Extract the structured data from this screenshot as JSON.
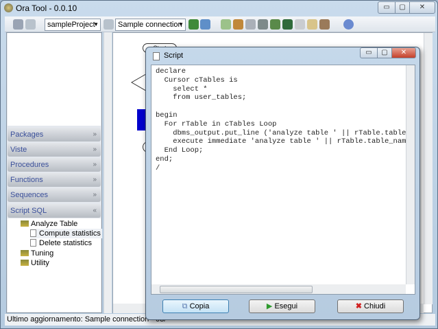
{
  "window": {
    "title": "Ora Tool - 0.0.10",
    "app_icon": "gear-icon"
  },
  "toolbar": {
    "project": "sampleProject",
    "connection": "Sample connection",
    "icons": [
      "save-icon",
      "wrench-icon",
      "wrench-icon",
      "connect-icon",
      "refresh-icon",
      "script-icon",
      "books-icon",
      "print-icon",
      "export-icon",
      "edit-icon",
      "table-icon",
      "compare-icon",
      "document-icon",
      "tool-icon",
      "info-icon"
    ]
  },
  "sidebar": {
    "sections": [
      {
        "label": "Packages",
        "expanded": false
      },
      {
        "label": "Viste",
        "expanded": false
      },
      {
        "label": "Procedures",
        "expanded": false
      },
      {
        "label": "Functions",
        "expanded": false
      },
      {
        "label": "Sequences",
        "expanded": false
      },
      {
        "label": "Script SQL",
        "expanded": true
      }
    ],
    "tree": [
      {
        "label": "Analyze Table",
        "type": "folder"
      },
      {
        "label": "Compute statistics",
        "type": "file",
        "selected": true
      },
      {
        "label": "Delete statistics",
        "type": "file"
      },
      {
        "label": "Tuning",
        "type": "folder"
      },
      {
        "label": "Utility",
        "type": "folder"
      }
    ]
  },
  "canvas": {
    "start_label": "Start"
  },
  "status": {
    "text": "Ultimo aggiornamento: Sample connection - 03/"
  },
  "dialog": {
    "title": "Script",
    "code": "declare\n  Cursor cTables is\n    select *\n    from user_tables;\n\nbegin\n  For rTable in cTables Loop\n    dbms_output.put_line ('analyze table ' || rTable.table_name\n    execute immediate 'analyze table ' || rTable.table_name\n  End Loop;\nend;\n/",
    "buttons": {
      "copy": "Copia",
      "run": "Esegui",
      "close": "Chiudi"
    }
  }
}
